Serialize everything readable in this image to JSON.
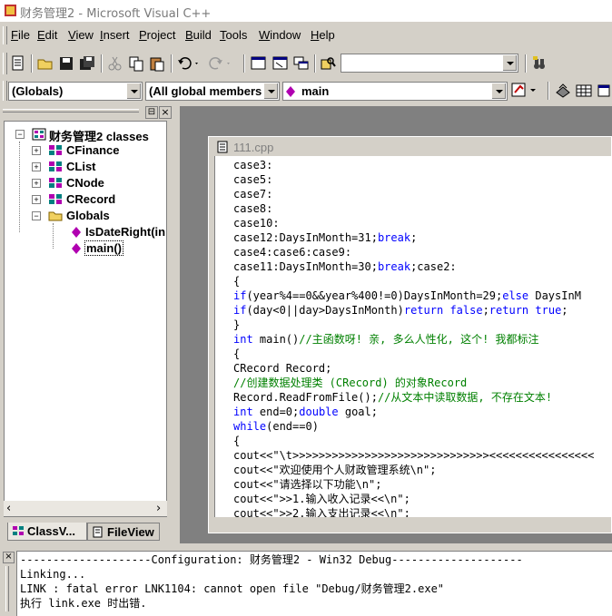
{
  "window": {
    "title": "财务管理2 - Microsoft Visual C++"
  },
  "menu": [
    {
      "label": "File",
      "key": "F",
      "rest": "ile"
    },
    {
      "label": "Edit",
      "key": "E",
      "rest": "dit"
    },
    {
      "label": "View",
      "key": "V",
      "rest": "iew"
    },
    {
      "label": "Insert",
      "key": "I",
      "rest": "nsert"
    },
    {
      "label": "Project",
      "key": "P",
      "rest": "roject"
    },
    {
      "label": "Build",
      "key": "B",
      "rest": "uild"
    },
    {
      "label": "Tools",
      "key": "T",
      "rest": "ools"
    },
    {
      "label": "Window",
      "key": "W",
      "rest": "indow"
    },
    {
      "label": "Help",
      "key": "H",
      "rest": "elp"
    }
  ],
  "toolbar": {
    "find_value": ""
  },
  "wizardbar": {
    "class_combo": "(Globals)",
    "filter_combo": "(All global members",
    "members_combo": "main"
  },
  "workspace": {
    "root": "财务管理2 classes",
    "classes": [
      "CFinance",
      "CList",
      "CNode",
      "CRecord"
    ],
    "globals_folder": "Globals",
    "functions": [
      "IsDateRight(in",
      "main()"
    ],
    "tabs": [
      "ClassV...",
      "FileView"
    ]
  },
  "editor": {
    "filename": "111.cpp",
    "lines": [
      [
        {
          "t": "case3:"
        }
      ],
      [
        {
          "t": "case5:"
        }
      ],
      [
        {
          "t": "case7:"
        }
      ],
      [
        {
          "t": "case8:"
        }
      ],
      [
        {
          "t": "case10:"
        }
      ],
      [
        {
          "t": "case12:DaysInMonth=31;"
        },
        {
          "t": "break",
          "c": "kw"
        },
        {
          "t": ";"
        }
      ],
      [
        {
          "t": "case4:case6:case9:"
        }
      ],
      [
        {
          "t": "case11:DaysInMonth=30;"
        },
        {
          "t": "break",
          "c": "kw"
        },
        {
          "t": ";case2:"
        }
      ],
      [
        {
          "t": "{"
        }
      ],
      [
        {
          "t": "if",
          "c": "kw"
        },
        {
          "t": "(year%4==0&&year%400!=0)DaysInMonth=29;"
        },
        {
          "t": "else",
          "c": "kw"
        },
        {
          "t": " DaysInM"
        }
      ],
      [
        {
          "t": "if",
          "c": "kw"
        },
        {
          "t": "(day<0||day>DaysInMonth)"
        },
        {
          "t": "return",
          "c": "kw"
        },
        {
          "t": " "
        },
        {
          "t": "false",
          "c": "kw"
        },
        {
          "t": ";"
        },
        {
          "t": "return",
          "c": "kw"
        },
        {
          "t": " "
        },
        {
          "t": "true",
          "c": "kw"
        },
        {
          "t": ";"
        }
      ],
      [
        {
          "t": "}"
        }
      ],
      [
        {
          "t": "int",
          "c": "kw"
        },
        {
          "t": " main()"
        },
        {
          "t": "//主函数呀! 亲, 多么人性化, 这个! 我都标注",
          "c": "cm"
        }
      ],
      [
        {
          "t": "{"
        }
      ],
      [
        {
          "t": "CRecord Record;"
        }
      ],
      [
        {
          "t": "//创建数据处理类 (CRecord) 的对象Record",
          "c": "cm"
        }
      ],
      [
        {
          "t": "Record.ReadFromFile();"
        },
        {
          "t": "//从文本中读取数据, 不存在文本!",
          "c": "cm"
        }
      ],
      [
        {
          "t": "int",
          "c": "kw"
        },
        {
          "t": " end=0;"
        },
        {
          "t": "double",
          "c": "kw"
        },
        {
          "t": " goal;"
        }
      ],
      [
        {
          "t": "while",
          "c": "kw"
        },
        {
          "t": "(end==0)"
        }
      ],
      [
        {
          "t": "{"
        }
      ],
      [
        {
          "t": "cout<<\"\\t>>>>>>>>>>>>>>>>>>>>>>>>>>>>>><<<<<<<<<<<<<<<<"
        }
      ],
      [
        {
          "t": "cout<<\"欢迎使用个人财政管理系统\\n\";"
        }
      ],
      [
        {
          "t": "cout<<\"请选择以下功能\\n\";"
        }
      ],
      [
        {
          "t": "cout<<\">>1.输入收入记录<<\\n\";"
        }
      ],
      [
        {
          "t": "cout<<\">>2.输入支出记录<<\\n\";"
        }
      ]
    ]
  },
  "output": {
    "lines": [
      "--------------------Configuration: 财务管理2 - Win32 Debug--------------------",
      "Linking...",
      "LINK : fatal error LNK1104: cannot open file \"Debug/财务管理2.exe\"",
      "执行 link.exe 时出错."
    ]
  },
  "colors": {
    "keyword": "#0000ff",
    "comment": "#008000",
    "chrome": "#d4d0c8"
  }
}
